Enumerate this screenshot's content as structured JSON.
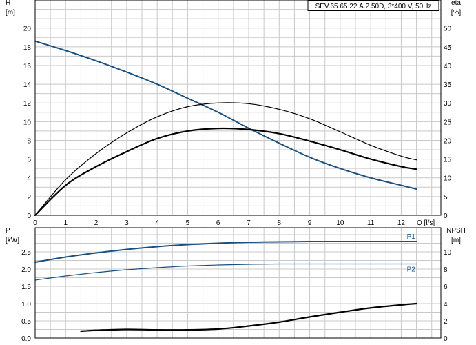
{
  "chart_data": [
    {
      "type": "line",
      "title": "SEV.65.65.22.A.2.50D, 3*400 V, 50Hz",
      "xlabel": "Q [l/s]",
      "xlim": [
        0,
        13.3
      ],
      "x_ticks": [
        0,
        1,
        2,
        3,
        4,
        5,
        6,
        7,
        8,
        9,
        10,
        11,
        12
      ],
      "ylabel": "H\n[m]",
      "ylabel_left": "H",
      "ylabel_left_unit": "[m]",
      "ylim": [
        0,
        23
      ],
      "y_ticks": [
        0,
        2,
        4,
        6,
        8,
        10,
        12,
        14,
        16,
        18,
        20
      ],
      "ylabel_right": "eta",
      "ylabel_right_unit": "[%]",
      "y2lim": [
        0,
        57.5
      ],
      "y2_ticks": [
        0,
        5,
        10,
        15,
        20,
        25,
        30,
        35,
        40,
        45,
        50
      ],
      "grid": true,
      "series": [
        {
          "axis": "left",
          "color": "#1a4f80",
          "x": [
            0,
            1,
            2,
            3,
            4,
            5,
            6,
            7,
            8,
            9,
            10,
            11,
            12,
            12.5
          ],
          "values": [
            18.6,
            17.6,
            16.5,
            15.3,
            14.0,
            12.5,
            11.0,
            9.3,
            7.7,
            6.2,
            5.0,
            4.0,
            3.2,
            2.8
          ]
        },
        {
          "axis": "right",
          "color": "#000000",
          "x": [
            0,
            1,
            2,
            3,
            4,
            5,
            6,
            7,
            8,
            9,
            10,
            11,
            12,
            12.5
          ],
          "values": [
            0,
            9.5,
            16.5,
            22.0,
            26.3,
            29.0,
            30.0,
            29.8,
            28.3,
            25.8,
            22.3,
            18.7,
            15.8,
            14.8
          ]
        },
        {
          "axis": "right",
          "color": "#000000",
          "x": [
            0,
            1,
            2,
            3,
            4,
            5,
            6,
            7,
            8,
            9,
            10,
            11,
            12,
            12.5
          ],
          "values": [
            0,
            8.0,
            13.0,
            17.0,
            20.5,
            22.5,
            23.2,
            22.9,
            21.8,
            19.8,
            17.5,
            15.0,
            13.0,
            12.3
          ]
        }
      ]
    },
    {
      "type": "line",
      "xlim": [
        0,
        13.3
      ],
      "ylabel_left": "P",
      "ylabel_left_unit": "[kW]",
      "ylim": [
        0,
        3.2
      ],
      "y_ticks": [
        0.0,
        0.5,
        1.0,
        1.5,
        2.0,
        2.5
      ],
      "y_tick_labels": [
        "0.0",
        "0.5",
        "1.0",
        "1.5",
        "2.0",
        "2.5"
      ],
      "ylabel_right": "NPSH",
      "ylabel_right_unit": "[m]",
      "y2lim": [
        0,
        12.8
      ],
      "y2_ticks": [
        0,
        2,
        4,
        6,
        8,
        10
      ],
      "grid": true,
      "series": [
        {
          "name": "P1",
          "axis": "left",
          "color": "#1a4f80",
          "x": [
            0,
            1,
            2,
            3,
            4,
            5,
            6,
            7,
            8,
            9,
            10,
            11,
            12,
            12.5
          ],
          "values": [
            2.2,
            2.35,
            2.47,
            2.57,
            2.65,
            2.71,
            2.75,
            2.78,
            2.79,
            2.8,
            2.8,
            2.8,
            2.8,
            2.8
          ]
        },
        {
          "name": "P2",
          "axis": "left",
          "color": "#1a4f80",
          "x": [
            0,
            1,
            2,
            3,
            4,
            5,
            6,
            7,
            8,
            9,
            10,
            11,
            12,
            12.5
          ],
          "values": [
            1.68,
            1.8,
            1.9,
            1.98,
            2.04,
            2.09,
            2.12,
            2.14,
            2.15,
            2.15,
            2.15,
            2.15,
            2.15,
            2.15
          ]
        },
        {
          "axis": "right",
          "color": "#000000",
          "x": [
            1.5,
            2,
            3,
            4,
            5,
            6,
            7,
            8,
            9,
            10,
            11,
            12,
            12.5
          ],
          "values": [
            0.8,
            0.9,
            1.0,
            0.95,
            0.95,
            1.05,
            1.4,
            1.85,
            2.45,
            3.0,
            3.5,
            3.85,
            4.0
          ]
        }
      ]
    }
  ]
}
